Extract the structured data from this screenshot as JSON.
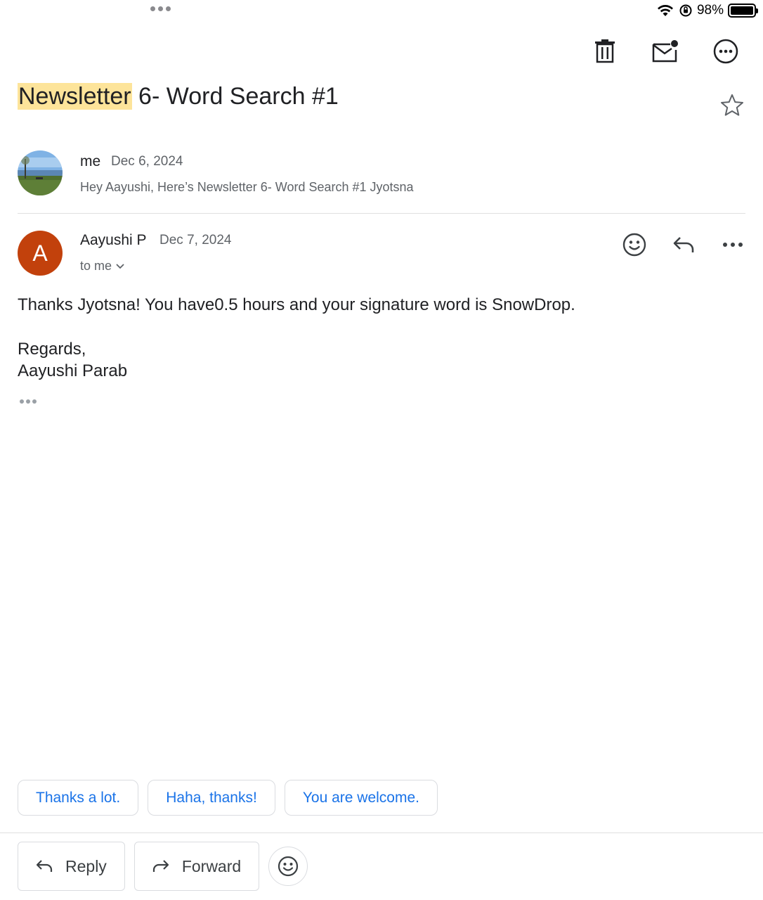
{
  "status_bar": {
    "battery_percent": "98%"
  },
  "toolbar": {
    "delete_icon": "trash-icon",
    "unread_icon": "mark-unread-icon",
    "more_icon": "more-circle-icon"
  },
  "subject": {
    "highlight": "Newsletter",
    "rest": " 6- Word Search #1"
  },
  "messages": [
    {
      "sender": "me",
      "date": "Dec 6, 2024",
      "snippet": "Hey Aayushi, Here’s Newsletter 6- Word Search #1 Jyotsna"
    },
    {
      "avatar_letter": "A",
      "avatar_color": "#c2410c",
      "sender": "Aayushi P",
      "date": "Dec 7, 2024",
      "recipients": "to me",
      "body": {
        "line1": "Thanks Jyotsna! You have0.5 hours and your signature word is SnowDrop.",
        "line2": "Regards,",
        "line3": "Aayushi Parab"
      }
    }
  ],
  "smart_replies": [
    "Thanks a lot.",
    "Haha, thanks!",
    "You are welcome."
  ],
  "bottom_actions": {
    "reply": "Reply",
    "forward": "Forward"
  },
  "colors": {
    "accent": "#1a73e8",
    "highlight": "#fde49a",
    "muted": "#5f6368"
  }
}
